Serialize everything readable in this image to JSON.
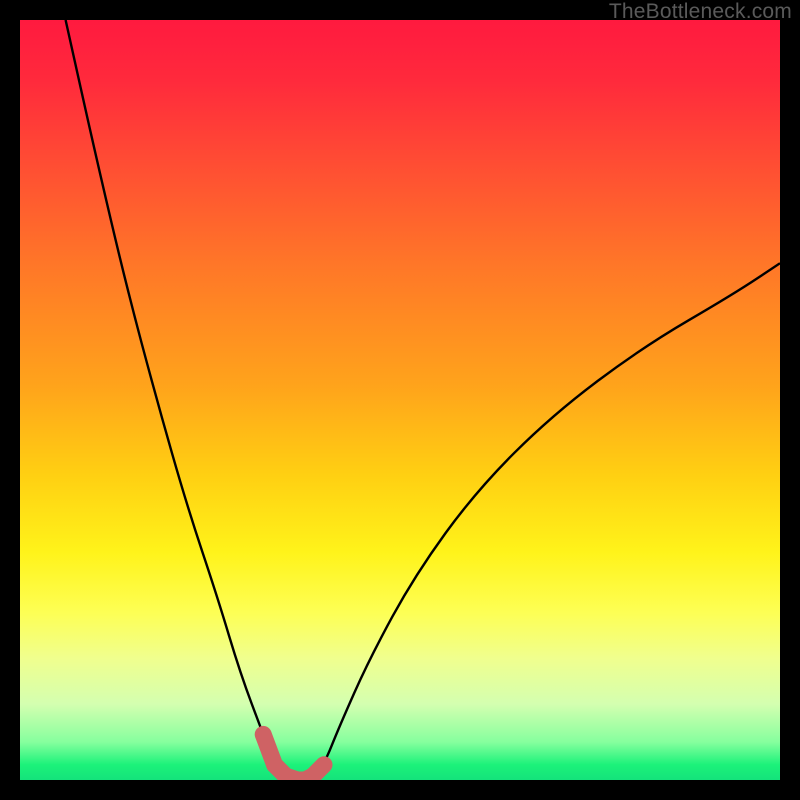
{
  "watermark": "TheBottleneck.com",
  "colors": {
    "curve_stroke": "#000000",
    "marker_fill": "#cf6264",
    "marker_stroke": "#cf6264",
    "background_black": "#000000"
  },
  "chart_data": {
    "type": "line",
    "title": "",
    "xlabel": "",
    "ylabel": "",
    "ylim": [
      0,
      100
    ],
    "xlim": [
      0,
      100
    ],
    "x": [
      6,
      10,
      14,
      18,
      22,
      26,
      29,
      32,
      33.5,
      35,
      36.5,
      37.5,
      38.5,
      40,
      42,
      46,
      52,
      60,
      70,
      82,
      94,
      100
    ],
    "values": [
      100,
      82,
      65,
      50,
      36,
      24,
      14,
      6,
      2,
      0.5,
      0,
      0,
      0.5,
      2,
      7,
      16,
      27,
      38,
      48,
      57,
      64,
      68
    ],
    "markers": {
      "x": [
        32,
        33.5,
        35,
        36.5,
        37.5,
        38.5,
        40
      ],
      "values": [
        6,
        2,
        0.5,
        0,
        0,
        0.5,
        2
      ]
    }
  }
}
